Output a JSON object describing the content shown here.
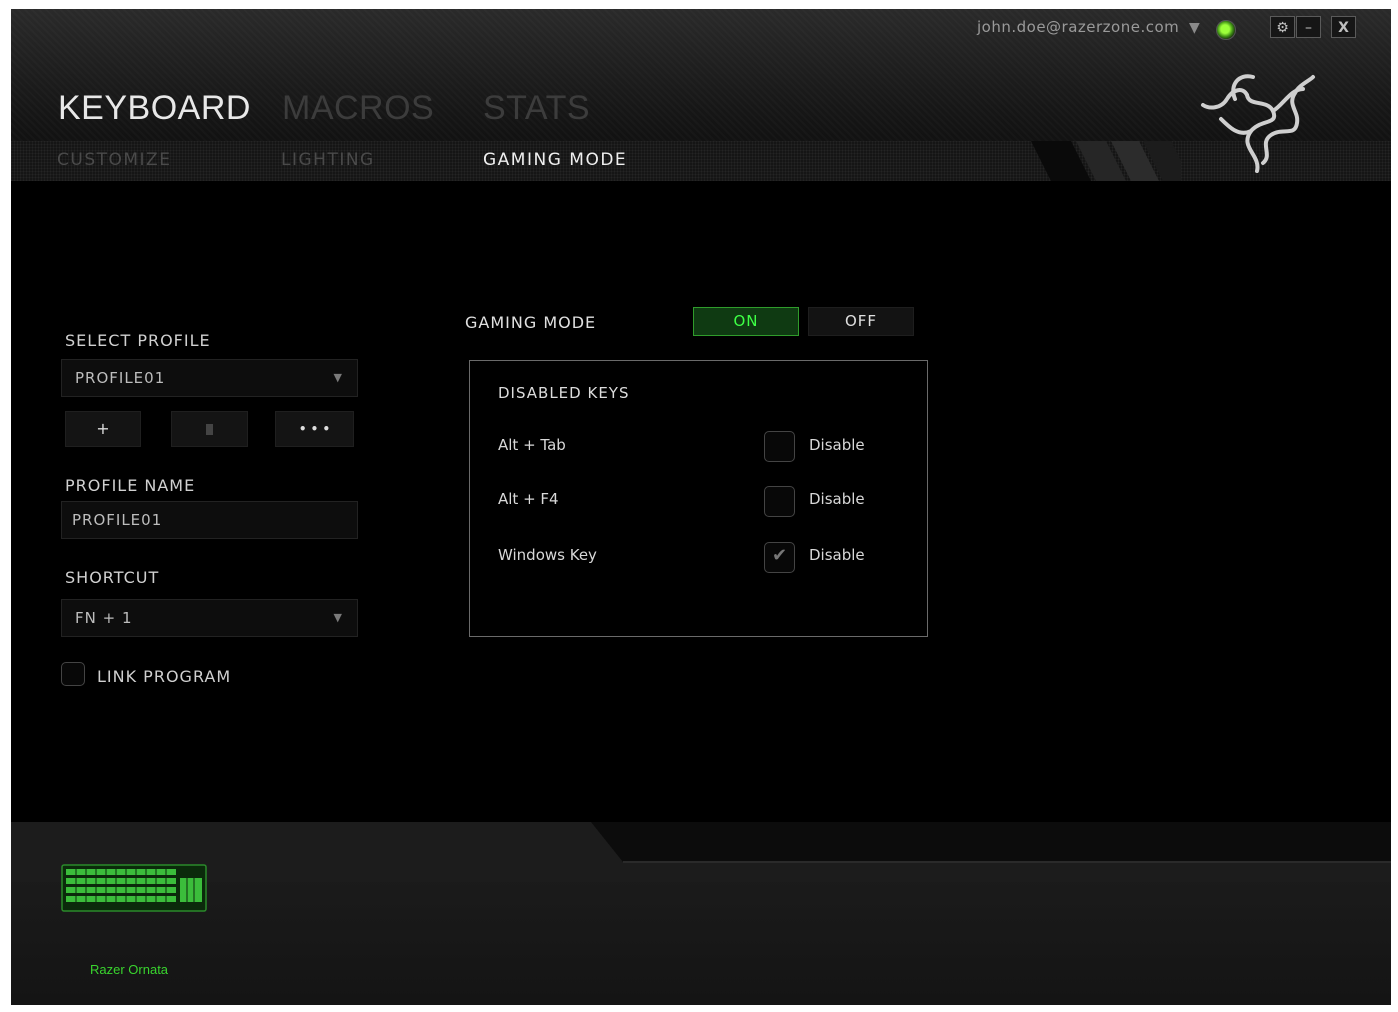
{
  "account": {
    "email": "john.doe@razerzone.com"
  },
  "window_controls": {
    "settings": "⚙",
    "minimize": "–",
    "close": "X"
  },
  "main_tabs": [
    {
      "label": "KEYBOARD",
      "active": true
    },
    {
      "label": "MACROS",
      "active": false
    },
    {
      "label": "STATS",
      "active": false
    }
  ],
  "sub_tabs": [
    {
      "label": "CUSTOMIZE",
      "active": false
    },
    {
      "label": "LIGHTING",
      "active": false
    },
    {
      "label": "GAMING MODE",
      "active": true
    }
  ],
  "profile": {
    "select_label": "SELECT PROFILE",
    "selected": "PROFILE01",
    "add_button": "+",
    "more_button": "• • •",
    "name_label": "PROFILE NAME",
    "name_value": "PROFILE01",
    "shortcut_label": "SHORTCUT",
    "shortcut_value": "FN + 1",
    "link_program_label": "LINK PROGRAM",
    "link_program_checked": false
  },
  "gaming_mode": {
    "label": "GAMING MODE",
    "on_label": "ON",
    "off_label": "OFF",
    "state": "on",
    "disabled_keys_title": "DISABLED KEYS",
    "keys": [
      {
        "name": "Alt + Tab",
        "checkbox_label": "Disable",
        "checked": false
      },
      {
        "name": "Alt + F4",
        "checkbox_label": "Disable",
        "checked": false
      },
      {
        "name": "Windows Key",
        "checkbox_label": "Disable",
        "checked": true
      }
    ]
  },
  "device": {
    "name": "Razer Ornata"
  },
  "colors": {
    "accent_green": "#3dff45",
    "background": "#000000"
  }
}
